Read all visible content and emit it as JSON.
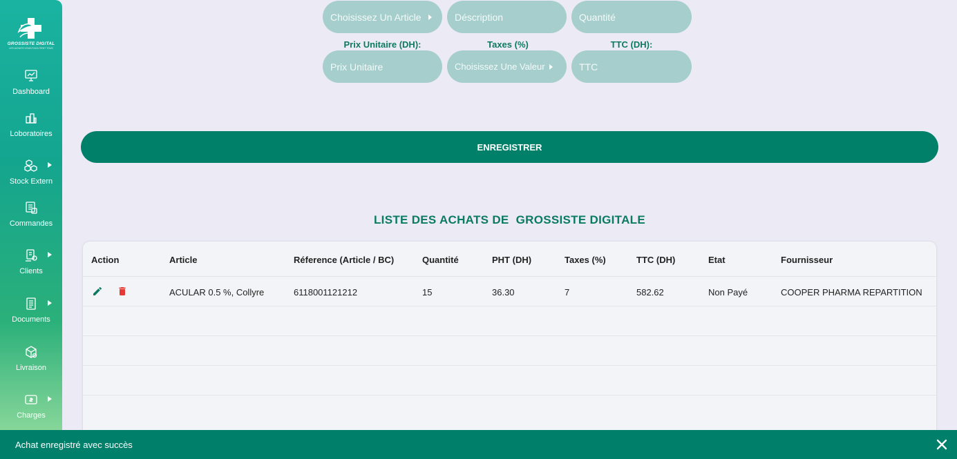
{
  "brand": {
    "name": "GROSSISTE DIGITAL",
    "tagline": "LES ACHATS VOUS FACILITENT TOUS"
  },
  "sidebar": {
    "items": [
      {
        "label": "Dashboard",
        "icon": "dashboard-icon",
        "has_submenu": false
      },
      {
        "label": "Loboratoires",
        "icon": "laboratory-icon",
        "has_submenu": false
      },
      {
        "label": "Stock Extern",
        "icon": "boxes-icon",
        "has_submenu": true
      },
      {
        "label": "Commandes",
        "icon": "orders-icon",
        "has_submenu": false
      },
      {
        "label": "Clients",
        "icon": "clients-icon",
        "has_submenu": true
      },
      {
        "label": "Documents",
        "icon": "documents-icon",
        "has_submenu": true
      },
      {
        "label": "Livraison",
        "icon": "delivery-icon",
        "has_submenu": false
      },
      {
        "label": "Charges",
        "icon": "charges-icon",
        "has_submenu": true
      }
    ]
  },
  "form": {
    "article_placeholder": "Choisissez Un Article",
    "description_placeholder": "Déscription",
    "quantity_placeholder": "Quantité",
    "unit_price_label": "Prix Unitaire (DH):",
    "unit_price_placeholder": "Prix Unitaire",
    "taxes_label": "Taxes (%)",
    "taxes_placeholder": "Choisissez Une Valeur",
    "ttc_label": "TTC (DH):",
    "ttc_placeholder": "TTC"
  },
  "save_button": "ENREGISTRER",
  "list_title": "LISTE DES ACHATS DE  GROSSISTE DIGITALE",
  "table": {
    "columns": [
      "Action",
      "Article",
      "Réference (Article / BC)",
      "Quantité",
      "PHT (DH)",
      "Taxes (%)",
      "TTC (DH)",
      "Etat",
      "Fournisseur"
    ],
    "rows": [
      {
        "article": "ACULAR 0.5 %, Collyre",
        "reference": "6118001121212",
        "quantite": "15",
        "pht": "36.30",
        "taxes": "7",
        "ttc": "582.62",
        "etat": "Non Payé",
        "fournisseur": "COOPER PHARMA REPARTITION"
      }
    ]
  },
  "snackbar": {
    "message": "Achat enregistré avec succès"
  },
  "colors": {
    "primary": "#008069",
    "title": "#0b7a62",
    "pill": "#a5cecc",
    "delete": "#e53935",
    "background": "#ecebf5"
  }
}
